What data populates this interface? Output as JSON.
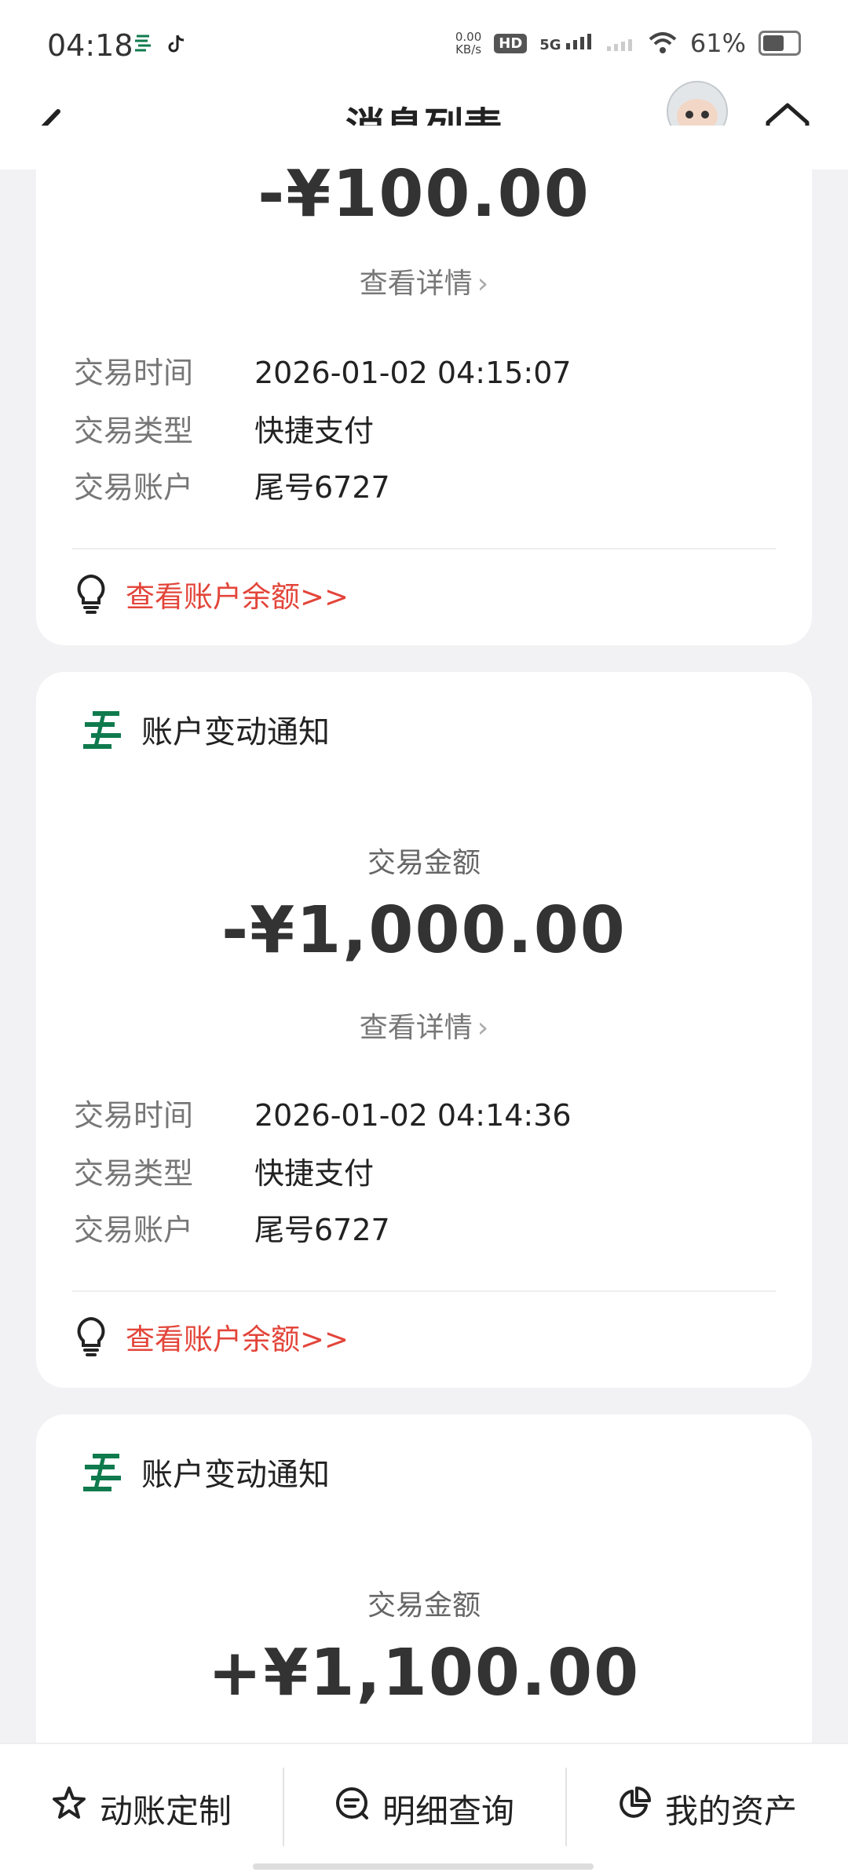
{
  "status": {
    "time": "04:18",
    "net_speed_value": "0.00",
    "net_speed_unit": "KB/s",
    "hd": "HD",
    "network": "5G",
    "battery": "61%",
    "battery_level": 0.61
  },
  "header": {
    "title": "消息列表"
  },
  "cards": [
    {
      "amount": "-¥100.00",
      "detail_link": "查看详情",
      "rows": [
        {
          "label": "交易时间",
          "value": "2026-01-02 04:15:07"
        },
        {
          "label": "交易类型",
          "value": "快捷支付"
        },
        {
          "label": "交易账户",
          "value": "尾号6727"
        }
      ],
      "balance_link": "查看账户余额>>"
    },
    {
      "title": "账户变动通知",
      "amount_label": "交易金额",
      "amount": "-¥1,000.00",
      "detail_link": "查看详情",
      "rows": [
        {
          "label": "交易时间",
          "value": "2026-01-02 04:14:36"
        },
        {
          "label": "交易类型",
          "value": "快捷支付"
        },
        {
          "label": "交易账户",
          "value": "尾号6727"
        }
      ],
      "balance_link": "查看账户余额>>"
    },
    {
      "title": "账户变动通知",
      "amount_label": "交易金额",
      "amount": "+¥1,100.00"
    }
  ],
  "bottom_nav": [
    {
      "label": "动账定制",
      "icon": "star-icon"
    },
    {
      "label": "明细查询",
      "icon": "search-list-icon"
    },
    {
      "label": "我的资产",
      "icon": "pie-chart-icon"
    }
  ],
  "colors": {
    "accent_red": "#e3453a",
    "logo_green": "#0f7a4d"
  }
}
